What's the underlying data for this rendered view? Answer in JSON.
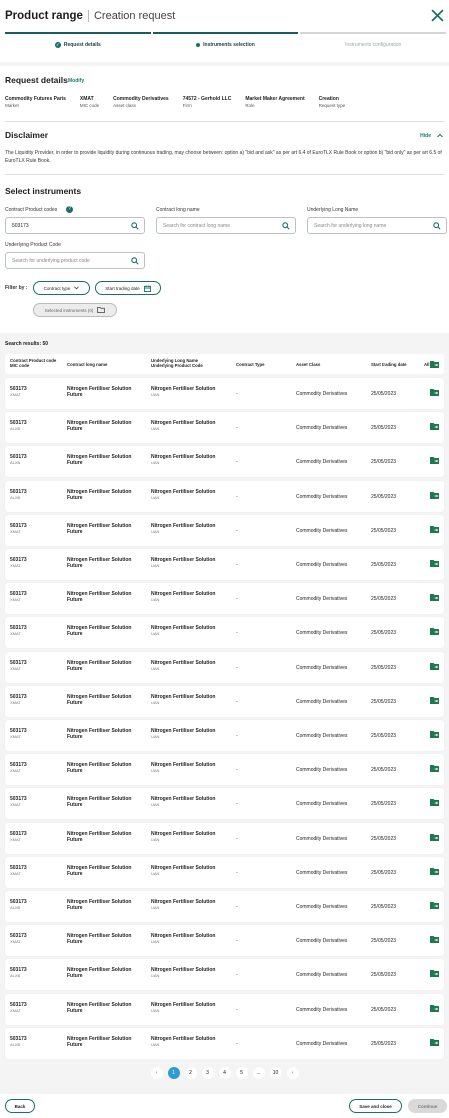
{
  "header": {
    "title": "Product range",
    "subtitle": "Creation request"
  },
  "steps": [
    {
      "label": "Request details",
      "state": "done"
    },
    {
      "label": "Instruments selection",
      "state": "current"
    },
    {
      "label": "Instruments configuration",
      "state": "pending"
    }
  ],
  "request_details": {
    "title": "Request details",
    "modify_label": "Modify",
    "fields": [
      {
        "value": "Commodity Futures Paris",
        "key": "Market"
      },
      {
        "value": "XMAT",
        "key": "MIC code"
      },
      {
        "value": "Commodity Derivatives",
        "key": "Asset class"
      },
      {
        "value": "74572 - Gerhold LLC",
        "key": "Firm"
      },
      {
        "value": "Market Maker Agreement",
        "key": "Role"
      },
      {
        "value": "Creation",
        "key": "Request type"
      }
    ]
  },
  "disclaimer": {
    "title": "Disclaimer",
    "toggle_label": "Hide",
    "text": "The Liquidity Provider, in order to provide liquidity during continuous trading, may choose between: option a) \"bid and ask\" as per art 6.4 of EuroTLX Rule Book or option b) \"bid only\" as per art 6.5 of EuroTLX Rule Book."
  },
  "select": {
    "title": "Select instruments",
    "contract_code_label": "Contract Product codes",
    "contract_code_value": "503173",
    "contract_long_label": "Contract long name",
    "contract_long_placeholder": "Search for contract long name",
    "underlying_long_label": "Underlying Long Name",
    "underlying_long_placeholder": "Search for underlying long name",
    "underlying_code_label": "Underlying Product Code",
    "underlying_code_placeholder": "Search for underlying product code",
    "filter_label": "Filter by :",
    "contract_type_label": "Contract type",
    "start_date_label": "Start trading date",
    "selected_label": "Selected instruments (0)"
  },
  "results": {
    "label": "Search results: 50",
    "headers": {
      "code": "Contract Product code",
      "mic": "MIC code",
      "long_name": "Contract long name",
      "und_name": "Underlying Long Name",
      "und_code": "Underlying Product Code",
      "type": "Contract Type",
      "asset": "Asset Class",
      "start": "Start trading date",
      "all": "All"
    },
    "rows": [
      {
        "code": "503173",
        "mic": "XMAT",
        "name1": "Nitrogen Fertiliser Solution",
        "name2": "Future",
        "und": "Nitrogen Fertiliser Solution",
        "und_code": "UAN",
        "type": "-",
        "asset": "Commodity Derivatives",
        "date": "25/05/2023"
      },
      {
        "code": "503173",
        "mic": "ALXB",
        "name1": "Nitrogen Fertiliser Solution",
        "name2": "Future",
        "und": "Nitrogen Fertiliser Solution",
        "und_code": "UAN",
        "type": "-",
        "asset": "Commodity Derivatives",
        "date": "25/05/2023"
      },
      {
        "code": "503173",
        "mic": "ALXB",
        "name1": "Nitrogen Fertiliser Solution",
        "name2": "Future",
        "und": "Nitrogen Fertiliser Solution",
        "und_code": "UAN",
        "type": "-",
        "asset": "Commodity Derivatives",
        "date": "25/05/2023"
      },
      {
        "code": "503173",
        "mic": "ALXB",
        "name1": "Nitrogen Fertiliser Solution",
        "name2": "Future",
        "und": "Nitrogen Fertiliser Solution",
        "und_code": "UAN",
        "type": "-",
        "asset": "Commodity Derivatives",
        "date": "25/05/2023"
      },
      {
        "code": "503173",
        "mic": "XMAT",
        "name1": "Nitrogen Fertiliser Solution",
        "name2": "Future",
        "und": "Nitrogen Fertiliser Solution",
        "und_code": "UAN",
        "type": "-",
        "asset": "Commodity Derivatives",
        "date": "25/05/2023"
      },
      {
        "code": "503173",
        "mic": "XMAT",
        "name1": "Nitrogen Fertiliser Solution",
        "name2": "Future",
        "und": "Nitrogen Fertiliser Solution",
        "und_code": "UAN",
        "type": "-",
        "asset": "Commodity Derivatives",
        "date": "25/05/2023"
      },
      {
        "code": "503173",
        "mic": "XMAT",
        "name1": "Nitrogen Fertiliser Solution",
        "name2": "Future",
        "und": "Nitrogen Fertiliser Solution",
        "und_code": "UAN",
        "type": "-",
        "asset": "Commodity Derivatives",
        "date": "25/05/2023"
      },
      {
        "code": "503173",
        "mic": "XMAT",
        "name1": "Nitrogen Fertiliser Solution",
        "name2": "Future",
        "und": "Nitrogen Fertiliser Solution",
        "und_code": "UAN",
        "type": "-",
        "asset": "Commodity Derivatives",
        "date": "25/05/2023"
      },
      {
        "code": "503173",
        "mic": "XMAT",
        "name1": "Nitrogen Fertiliser Solution",
        "name2": "Future",
        "und": "Nitrogen Fertiliser Solution",
        "und_code": "UAN",
        "type": "-",
        "asset": "Commodity Derivatives",
        "date": "25/05/2023"
      },
      {
        "code": "503173",
        "mic": "XMAT",
        "name1": "Nitrogen Fertiliser Solution",
        "name2": "Future",
        "und": "Nitrogen Fertiliser Solution",
        "und_code": "UAN",
        "type": "-",
        "asset": "Commodity Derivatives",
        "date": "25/05/2023"
      },
      {
        "code": "503173",
        "mic": "XMAT",
        "name1": "Nitrogen Fertiliser Solution",
        "name2": "Future",
        "und": "Nitrogen Fertiliser Solution",
        "und_code": "UAN",
        "type": "-",
        "asset": "Commodity Derivatives",
        "date": "25/05/2023"
      },
      {
        "code": "503173",
        "mic": "XMAT",
        "name1": "Nitrogen Fertiliser Solution",
        "name2": "Future",
        "und": "Nitrogen Fertiliser Solution",
        "und_code": "UAN",
        "type": "-",
        "asset": "Commodity Derivatives",
        "date": "25/05/2023"
      },
      {
        "code": "503173",
        "mic": "XMAT",
        "name1": "Nitrogen Fertiliser Solution",
        "name2": "Future",
        "und": "Nitrogen Fertiliser Solution",
        "und_code": "UAN",
        "type": "-",
        "asset": "Commodity Derivatives",
        "date": "25/05/2023"
      },
      {
        "code": "503173",
        "mic": "XMAT",
        "name1": "Nitrogen Fertiliser Solution",
        "name2": "Future",
        "und": "Nitrogen Fertiliser Solution",
        "und_code": "UAN",
        "type": "-",
        "asset": "Commodity Derivatives",
        "date": "25/05/2023"
      },
      {
        "code": "503173",
        "mic": "XMAT",
        "name1": "Nitrogen Fertiliser Solution",
        "name2": "Future",
        "und": "Nitrogen Fertiliser Solution",
        "und_code": "UAN",
        "type": "-",
        "asset": "Commodity Derivatives",
        "date": "25/05/2023"
      },
      {
        "code": "503173",
        "mic": "ALXB",
        "name1": "Nitrogen Fertiliser Solution",
        "name2": "Future",
        "und": "Nitrogen Fertiliser Solution",
        "und_code": "UAN",
        "type": "-",
        "asset": "Commodity Derivatives",
        "date": "25/05/2023"
      },
      {
        "code": "503173",
        "mic": "XMAT",
        "name1": "Nitrogen Fertiliser Solution",
        "name2": "Future",
        "und": "Nitrogen Fertiliser Solution",
        "und_code": "UAN",
        "type": "-",
        "asset": "Commodity Derivatives",
        "date": "25/05/2023"
      },
      {
        "code": "503173",
        "mic": "ALXB",
        "name1": "Nitrogen Fertiliser Solution",
        "name2": "Future",
        "und": "Nitrogen Fertiliser Solution",
        "und_code": "UAN",
        "type": "-",
        "asset": "Commodity Derivatives",
        "date": "25/05/2023"
      },
      {
        "code": "503173",
        "mic": "XMAT",
        "name1": "Nitrogen Fertiliser Solution",
        "name2": "Future",
        "und": "Nitrogen Fertiliser Solution",
        "und_code": "UAN",
        "type": "-",
        "asset": "Commodity Derivatives",
        "date": "25/05/2023"
      },
      {
        "code": "503173",
        "mic": "ALXB",
        "name1": "Nitrogen Fertiliser Solution",
        "name2": "Future",
        "und": "Nitrogen Fertiliser Solution",
        "und_code": "UAN",
        "type": "-",
        "asset": "Commodity Derivatives",
        "date": "25/05/2023"
      }
    ]
  },
  "pagination": {
    "prev": "‹",
    "pages": [
      "1",
      "2",
      "3",
      "4",
      "5",
      "...",
      "10"
    ],
    "next": "›",
    "current": "1"
  },
  "footer": {
    "back_label": "Back",
    "save_label": "Save and close",
    "continue_label": "Continue"
  },
  "colors": {
    "accent": "#1b6e6a",
    "page_active": "#2c9cd6"
  }
}
